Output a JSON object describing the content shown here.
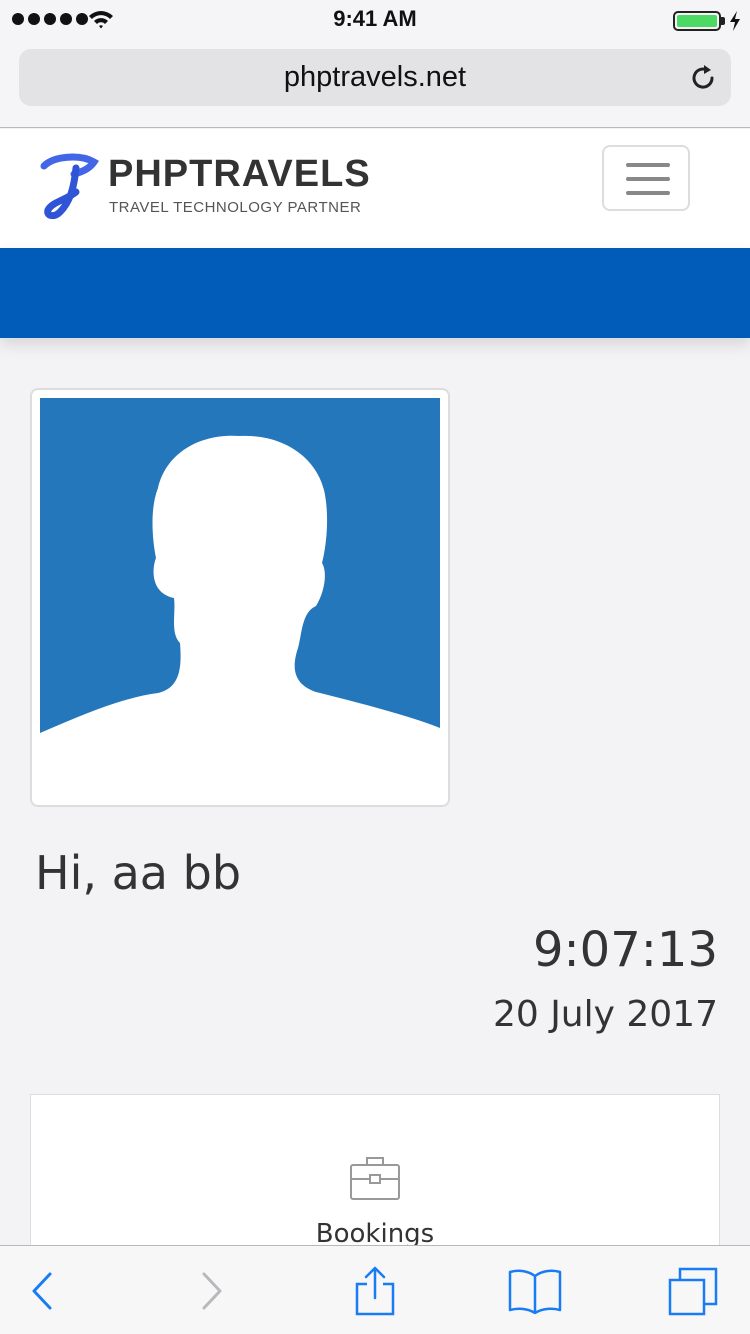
{
  "status_bar": {
    "time": "9:41 AM",
    "battery_level": 1.0
  },
  "browser": {
    "url": "phptravels.net"
  },
  "site": {
    "logo_title": "PHPTRAVELS",
    "logo_subtitle": "TRAVEL TECHNOLOGY PARTNER"
  },
  "profile": {
    "greeting": "Hi, aa bb",
    "time": "9:07:13",
    "date": "20 July 2017"
  },
  "dashboard": {
    "bookings_label": "Bookings"
  },
  "colors": {
    "brand_blue": "#005cb8",
    "avatar_bg": "#2577bb",
    "ios_blue": "#1a7cf3"
  },
  "icons": [
    "wifi-icon",
    "battery-icon",
    "reload-icon",
    "menu-icon",
    "briefcase-icon",
    "back-icon",
    "forward-icon",
    "share-icon",
    "bookmarks-icon",
    "tabs-icon"
  ]
}
